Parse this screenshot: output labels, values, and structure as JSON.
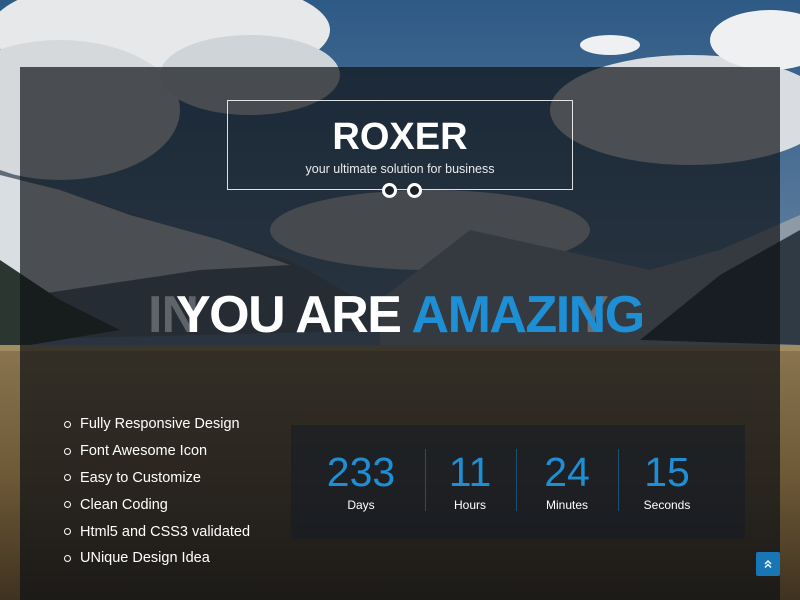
{
  "brand": {
    "name": "ROXER",
    "tagline": "your ultimate solution for business"
  },
  "headline": {
    "ghost_left": "IN",
    "prefix": "YOU ARE",
    "accent": "AMAZING",
    "ghost_right": "Y"
  },
  "features": [
    "Fully Responsive Design",
    "Font Awesome Icon",
    "Easy to Customize",
    "Clean Coding",
    "Html5 and CSS3 validated",
    "UNique Design Idea"
  ],
  "countdown": [
    {
      "value": "233",
      "label": "Days"
    },
    {
      "value": "11",
      "label": "Hours"
    },
    {
      "value": "24",
      "label": "Minutes"
    },
    {
      "value": "15",
      "label": "Seconds"
    }
  ],
  "colors": {
    "accent": "#1e8fd5",
    "button": "#1976b4"
  },
  "icons": {
    "scroll_top": "double-chevron-up-icon",
    "slider": "carousel-dot-icon"
  }
}
